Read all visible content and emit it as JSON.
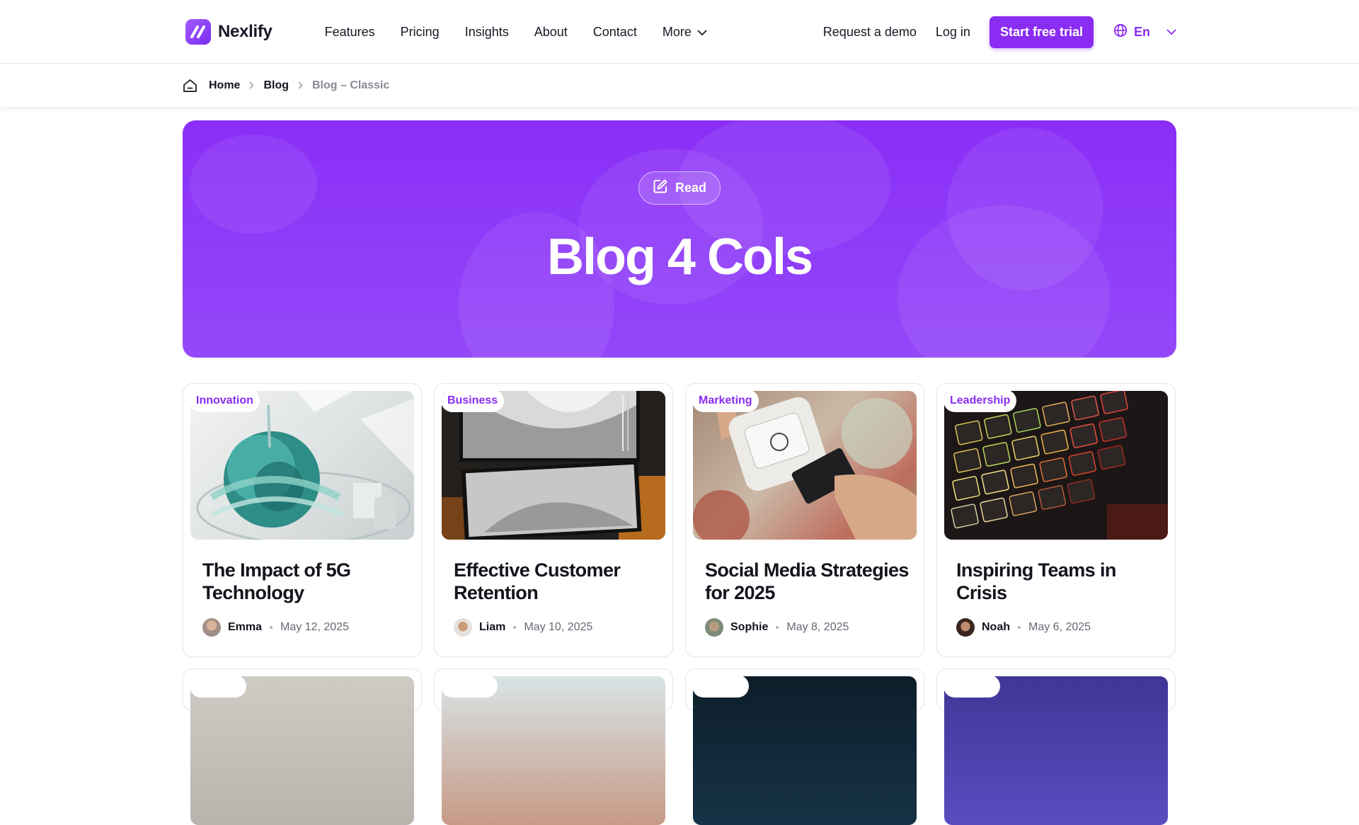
{
  "brand": {
    "name": "Nexlify"
  },
  "nav": {
    "items": [
      {
        "label": "Features"
      },
      {
        "label": "Pricing"
      },
      {
        "label": "Insights"
      },
      {
        "label": "About"
      },
      {
        "label": "Contact"
      },
      {
        "label": "More"
      }
    ],
    "request_demo": "Request a demo",
    "login": "Log in",
    "trial": "Start free trial",
    "language": "En"
  },
  "breadcrumb": {
    "home": "Home",
    "blog": "Blog",
    "current": "Blog – Classic"
  },
  "hero": {
    "badge": "Read",
    "title": "Blog 4 Cols"
  },
  "posts": [
    {
      "tag": "Innovation",
      "title": "The Impact of 5G Technology",
      "author": "Emma",
      "date": "May 12, 2025"
    },
    {
      "tag": "Business",
      "title": "Effective Customer Retention",
      "author": "Liam",
      "date": "May 10, 2025"
    },
    {
      "tag": "Marketing",
      "title": "Social Media Strategies for 2025",
      "author": "Sophie",
      "date": "May 8, 2025"
    },
    {
      "tag": "Leadership",
      "title": "Inspiring Teams in Crisis",
      "author": "Noah",
      "date": "May 6, 2025"
    }
  ],
  "colors": {
    "accent": "#8a2cf2",
    "hero_bg": "#8a2ef7",
    "text": "#15131c",
    "muted": "#6b6773"
  }
}
